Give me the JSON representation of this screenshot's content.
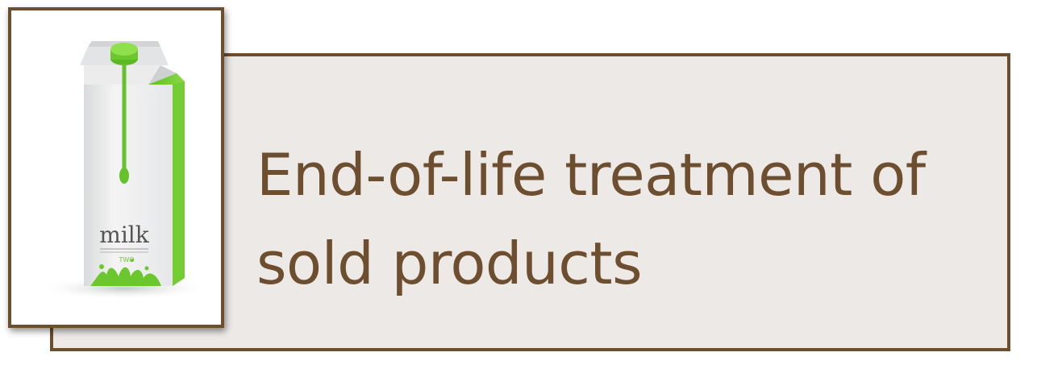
{
  "title": "End-of-life treatment of sold products",
  "image": {
    "carton_label": "milk",
    "carton_sublabel": "TWO"
  },
  "colors": {
    "frame": "#6d4e2e",
    "panel": "#ece9e7",
    "title_text": "#6d4e2e",
    "carton_accent": "#6cc72f"
  }
}
